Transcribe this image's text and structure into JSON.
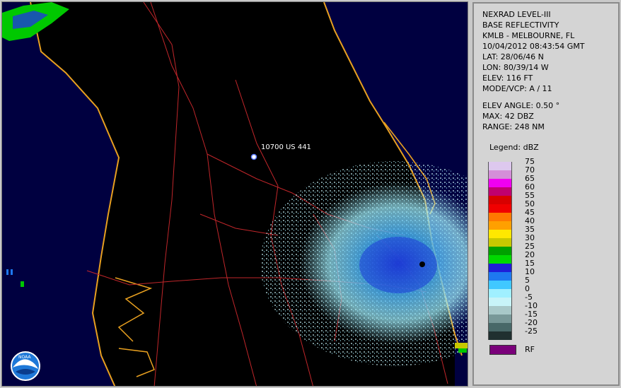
{
  "map": {
    "location_marker_label": "10700 US 441",
    "logo_text": "NOAA"
  },
  "info": {
    "line1": "NEXRAD LEVEL-III",
    "line2": "BASE REFLECTIVITY",
    "station": "KMLB - MELBOURNE, FL",
    "datetime": "10/04/2012 08:43:54 GMT",
    "lat": "LAT: 28/06/46 N",
    "lon": "LON: 80/39/14 W",
    "elev": "ELEV: 116 FT",
    "mode": "MODE/VCP: A / 11",
    "elev_angle": "ELEV ANGLE: 0.50 °",
    "max": "MAX: 42 DBZ",
    "range": "RANGE: 248 NM"
  },
  "legend": {
    "title": "Legend: dBZ",
    "levels": [
      {
        "label": "75",
        "color": "#ddc8ee"
      },
      {
        "label": "70",
        "color": "#d48ed8"
      },
      {
        "label": "65",
        "color": "#f000f0"
      },
      {
        "label": "60",
        "color": "#c00070"
      },
      {
        "label": "55",
        "color": "#d80000"
      },
      {
        "label": "50",
        "color": "#f00000"
      },
      {
        "label": "45",
        "color": "#ff7800"
      },
      {
        "label": "40",
        "color": "#ffa000"
      },
      {
        "label": "35",
        "color": "#ffe800"
      },
      {
        "label": "30",
        "color": "#c8c800"
      },
      {
        "label": "25",
        "color": "#00a000"
      },
      {
        "label": "20",
        "color": "#00d800"
      },
      {
        "label": "15",
        "color": "#1e1ed8"
      },
      {
        "label": "10",
        "color": "#1e78f0"
      },
      {
        "label": "5",
        "color": "#40c8ff"
      },
      {
        "label": "0",
        "color": "#a0f0ff"
      },
      {
        "label": "-5",
        "color": "#c8f4f8"
      },
      {
        "label": "-10",
        "color": "#a8c8c8"
      },
      {
        "label": "-15",
        "color": "#789898"
      },
      {
        "label": "-20",
        "color": "#486868"
      },
      {
        "label": "-25",
        "color": "#203030"
      }
    ],
    "rf_label": "RF",
    "rf_color": "#7a007a"
  }
}
